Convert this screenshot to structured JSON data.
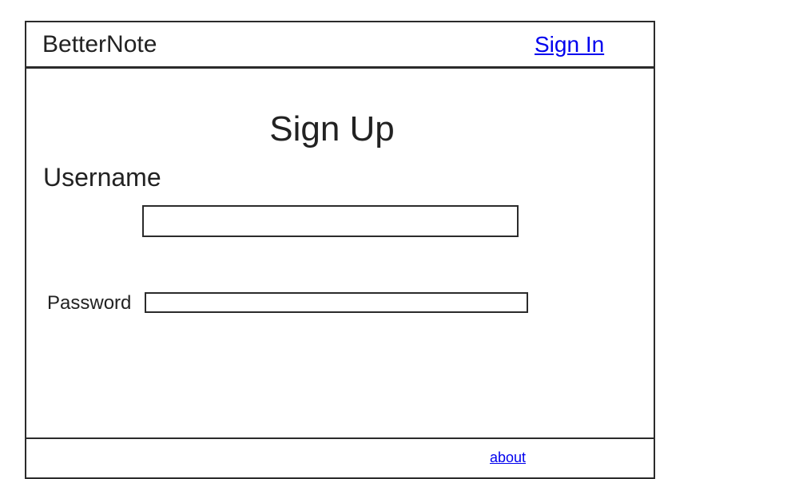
{
  "header": {
    "brand": "BetterNote",
    "signin_label": "Sign In"
  },
  "main": {
    "title": "Sign Up",
    "username_label": "Username",
    "username_value": "",
    "password_label": "Password",
    "password_value": ""
  },
  "footer": {
    "about_label": "about"
  },
  "colors": {
    "link": "#0000ee",
    "border": "#2b2b2b",
    "text": "#222222"
  }
}
